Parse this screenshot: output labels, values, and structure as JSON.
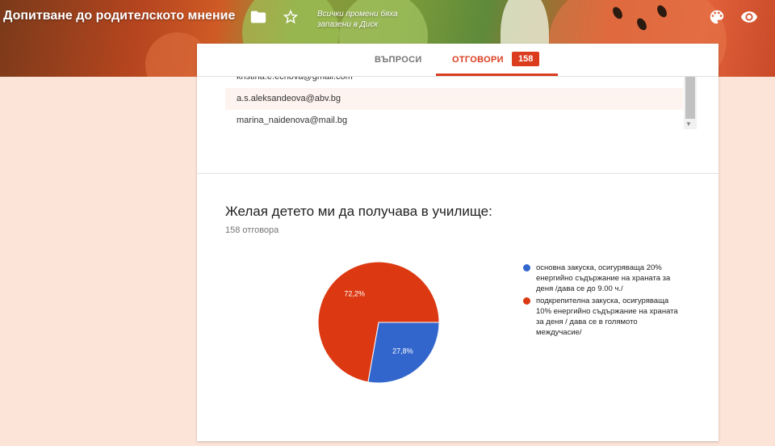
{
  "header": {
    "title": "Допитване до родителското мнение",
    "saved_line1": "Всички промени бяха",
    "saved_line2": "запазени в Диск"
  },
  "tabs": [
    {
      "label": "ВЪПРОСИ",
      "active": false
    },
    {
      "label": "ОТГОВОРИ",
      "active": true
    }
  ],
  "responses_badge": "158",
  "emails": [
    "kristina.e.echova@gmail.com",
    "a.s.aleksandeova@abv.bg",
    "marina_naidenova@mail.bg"
  ],
  "question": {
    "title": "Желая детето ми да получава в училище:",
    "count_label": "158 отговора"
  },
  "chart_data": {
    "type": "pie",
    "categories": [
      "основна закуска, осигуряваща 20% енергийно съдържание на храната за деня /дава се до 9.00 ч./",
      "подкрепителна закуска, осигуряваща 10% енергийно съдържание на храната за деня / дава се в голямото междучасие/"
    ],
    "values": [
      27.8,
      72.2
    ],
    "value_labels": [
      "27,8%",
      "72,2%"
    ],
    "colors": [
      "#3366cc",
      "#dc3912"
    ],
    "legend_placement": "right"
  }
}
